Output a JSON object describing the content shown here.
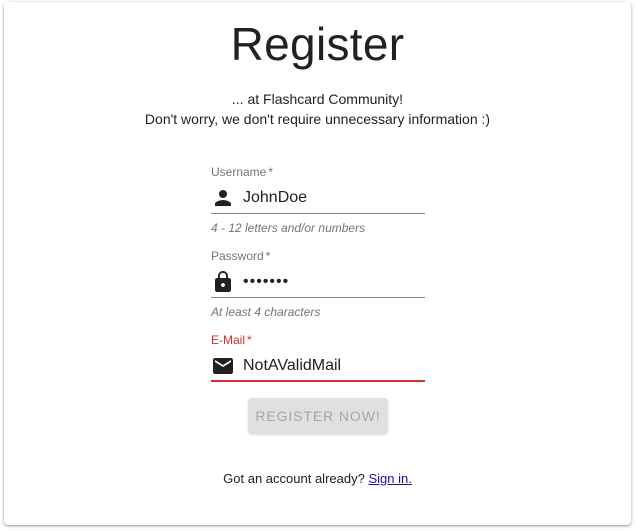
{
  "header": {
    "title": "Register",
    "subtitle_line1": "... at Flashcard Community!",
    "subtitle_line2": "Don't worry, we don't require unnecessary information :)"
  },
  "form": {
    "username": {
      "label": "Username",
      "required_mark": "*",
      "value": "JohnDoe",
      "hint": "4 - 12 letters and/or numbers",
      "icon": "person-icon"
    },
    "password": {
      "label": "Password",
      "required_mark": "*",
      "value": "•••••••",
      "hint": "At least 4 characters",
      "icon": "lock-icon"
    },
    "email": {
      "label": "E-Mail",
      "required_mark": "*",
      "value": "NotAValidMail",
      "icon": "mail-icon",
      "state": "error"
    },
    "submit_label": "REGISTER NOW!"
  },
  "footer": {
    "prompt": "Got an account already?",
    "link_label": "Sign in."
  },
  "colors": {
    "error": "#d32f2f",
    "link": "#1a0dab",
    "button_disabled_bg": "#e0e0e0",
    "button_disabled_text": "#a6a6a6"
  }
}
